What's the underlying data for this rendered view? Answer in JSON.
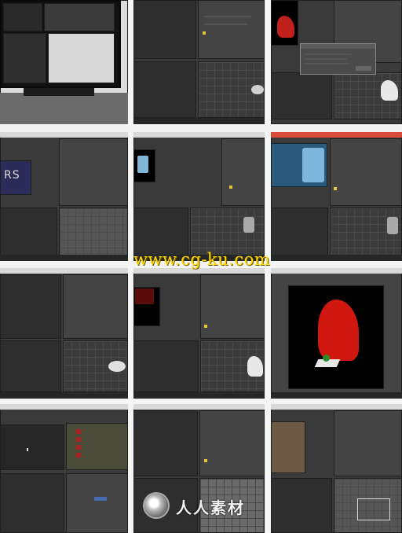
{
  "page": {
    "background": "#f4f4f4",
    "accent": "#e5c83a",
    "dark_panel": "#2e2e2e"
  },
  "watermarks": {
    "top": "www.cg-ku.com",
    "bottom": "人人素材"
  },
  "tiles": [
    {
      "id": "r1c1",
      "kind": "photo-monitor",
      "title": ""
    },
    {
      "id": "r1c2",
      "kind": "ui",
      "title": ""
    },
    {
      "id": "r1c3",
      "kind": "ui-dialog",
      "title": "",
      "dialog_title": ""
    },
    {
      "id": "r2c1",
      "kind": "ui",
      "title": "",
      "panel_text": "RS"
    },
    {
      "id": "r2c2",
      "kind": "ui",
      "title": ""
    },
    {
      "id": "r2c3",
      "kind": "ui",
      "title": ""
    },
    {
      "id": "r3c1",
      "kind": "ui",
      "title": ""
    },
    {
      "id": "r3c2",
      "kind": "ui",
      "title": ""
    },
    {
      "id": "r3c3",
      "kind": "ui-render",
      "title": ""
    },
    {
      "id": "r4c1",
      "kind": "ui",
      "title": ""
    },
    {
      "id": "r4c2",
      "kind": "ui",
      "title": ""
    },
    {
      "id": "r4c3",
      "kind": "ui",
      "title": ""
    }
  ]
}
